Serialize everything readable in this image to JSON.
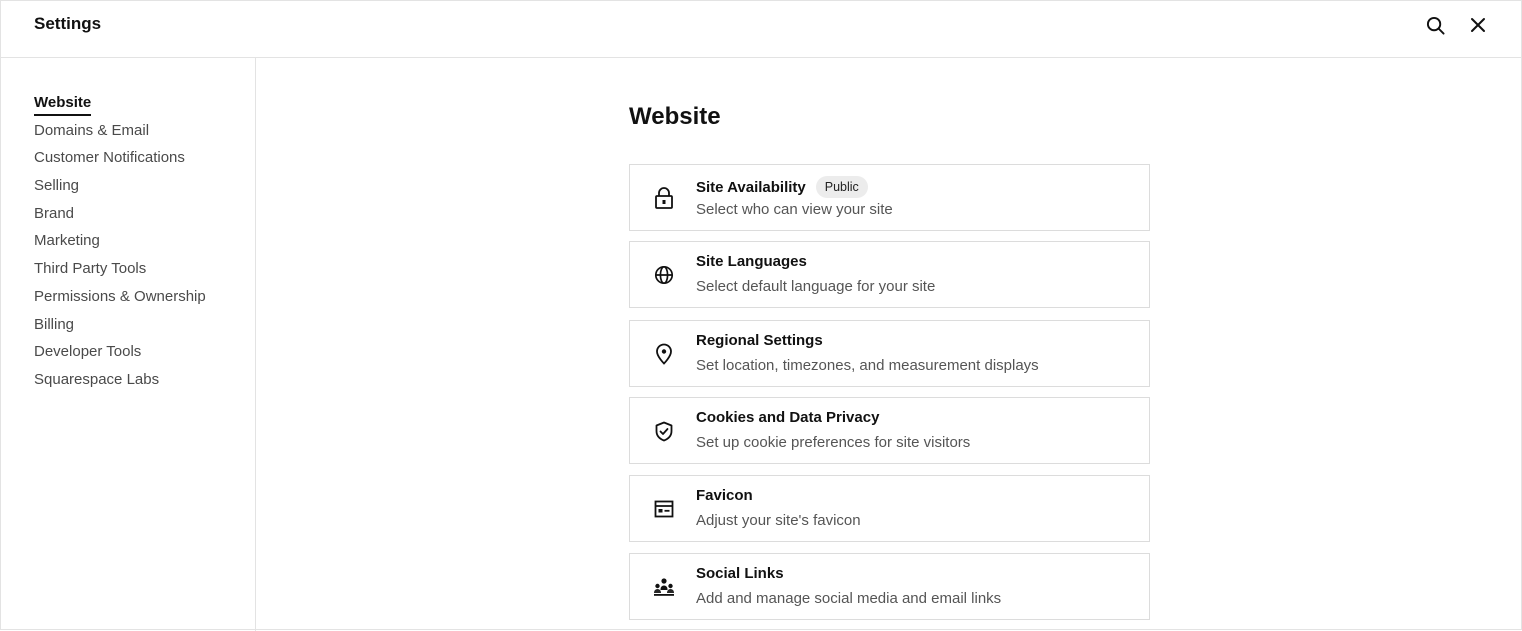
{
  "header": {
    "title": "Settings",
    "search_icon": "search-icon",
    "close_icon": "close-icon"
  },
  "sidebar": {
    "items": [
      {
        "label": "Website",
        "active": true
      },
      {
        "label": "Domains & Email"
      },
      {
        "label": "Customer Notifications"
      },
      {
        "label": "Selling"
      },
      {
        "label": "Brand"
      },
      {
        "label": "Marketing"
      },
      {
        "label": "Third Party Tools"
      },
      {
        "label": "Permissions & Ownership"
      },
      {
        "label": "Billing"
      },
      {
        "label": "Developer Tools"
      },
      {
        "label": "Squarespace Labs"
      }
    ]
  },
  "main": {
    "title": "Website",
    "cards": [
      {
        "title": "Site Availability",
        "badge": "Public",
        "description": "Select who can view your site",
        "icon": "lock-icon"
      },
      {
        "title": "Site Languages",
        "description": "Select default language for your site",
        "icon": "globe-icon"
      },
      {
        "title": "Regional Settings",
        "description": "Set location, timezones, and measurement displays",
        "icon": "location-pin-icon"
      },
      {
        "title": "Cookies and Data Privacy",
        "description": "Set up cookie preferences for site visitors",
        "icon": "shield-check-icon"
      },
      {
        "title": "Favicon",
        "description": "Adjust your site's favicon",
        "icon": "browser-window-icon"
      },
      {
        "title": "Social Links",
        "description": "Add and manage social media and email links",
        "icon": "people-icon"
      }
    ]
  }
}
